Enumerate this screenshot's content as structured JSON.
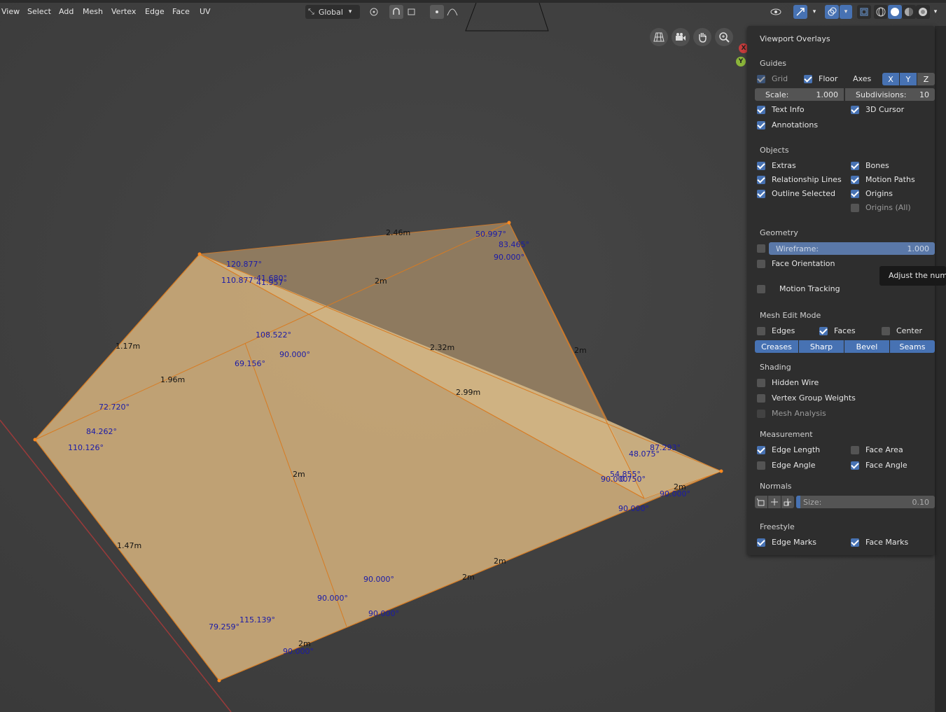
{
  "menu": [
    "View",
    "Select",
    "Add",
    "Mesh",
    "Vertex",
    "Edge",
    "Face",
    "UV"
  ],
  "header": {
    "orientation": "Global"
  },
  "axes_gizmo": {
    "x": "X",
    "y": "Y"
  },
  "overlays": {
    "title": "Viewport Overlays",
    "guides": {
      "label": "Guides",
      "grid": "Grid",
      "floor": "Floor",
      "axes": "Axes",
      "axis_x": "X",
      "axis_y": "Y",
      "axis_z": "Z",
      "scale_label": "Scale:",
      "scale_value": "1.000",
      "subdiv_label": "Subdivisions:",
      "subdiv_value": "10",
      "text_info": "Text Info",
      "cursor": "3D Cursor",
      "annotations": "Annotations"
    },
    "objects": {
      "label": "Objects",
      "extras": "Extras",
      "bones": "Bones",
      "relationship_lines": "Relationship Lines",
      "motion_paths": "Motion Paths",
      "outline_selected": "Outline Selected",
      "origins": "Origins",
      "origins_all": "Origins (All)"
    },
    "geometry": {
      "label": "Geometry",
      "wireframe_label": "Wireframe:",
      "wireframe_value": "1.000",
      "face_orientation": "Face Orientation",
      "motion_tracking": "Motion Tracking"
    },
    "mesh_edit": {
      "label": "Mesh Edit Mode",
      "edges": "Edges",
      "faces": "Faces",
      "center": "Center",
      "creases": "Creases",
      "sharp": "Sharp",
      "bevel": "Bevel",
      "seams": "Seams"
    },
    "shading": {
      "label": "Shading",
      "hidden_wire": "Hidden Wire",
      "vertex_group_weights": "Vertex Group Weights",
      "mesh_analysis": "Mesh Analysis"
    },
    "measurement": {
      "label": "Measurement",
      "edge_length": "Edge Length",
      "face_area": "Face Area",
      "edge_angle": "Edge Angle",
      "face_angle": "Face Angle"
    },
    "normals": {
      "label": "Normals",
      "size_label": "Size:",
      "size_value": "0.10"
    },
    "freestyle": {
      "label": "Freestyle",
      "edge_marks": "Edge Marks",
      "face_marks": "Face Marks"
    }
  },
  "tooltip": "Adjust the numb",
  "measurements": {
    "edges": [
      "2.46m",
      "2m",
      "1.17m",
      "1.96m",
      "2.32m",
      "2m",
      "2.99m",
      "2m",
      "1.47m",
      "2m",
      "2m",
      "2m",
      "2m"
    ],
    "angles": [
      "50.997°",
      "83.465°",
      "90.000°",
      "120.877°",
      "110.877°",
      "41.680°",
      "41.957°",
      "108.522°",
      "69.156°",
      "90.000°",
      "72.720°",
      "84.262°",
      "110.126°",
      "87.293°",
      "48.075°",
      "54.855°",
      "90.000°",
      "0.750°",
      "90.000°",
      "90.000°",
      "90.000°",
      "90.000°",
      "90.000°",
      "115.139°",
      "79.259°",
      "90.000°"
    ]
  }
}
